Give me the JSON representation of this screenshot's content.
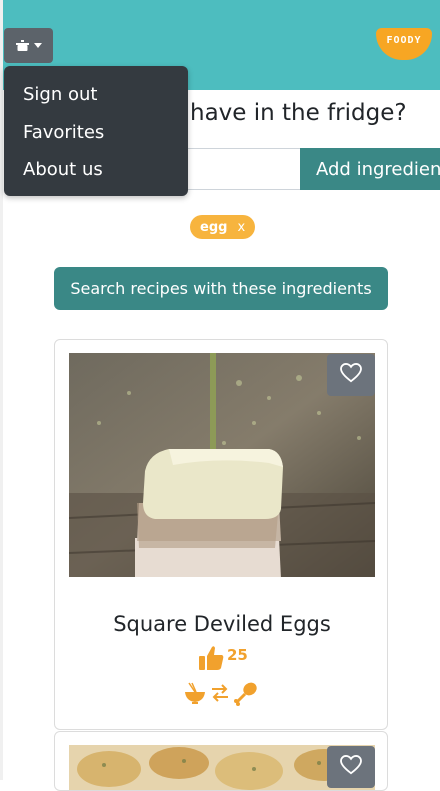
{
  "header": {
    "menu_toggle_icon": "cooking-pot-icon",
    "logo_text": "FOODY",
    "brand_color": "#4dbdbf",
    "accent_color": "#f7a623"
  },
  "dropdown": {
    "items": [
      {
        "label": "Sign out"
      },
      {
        "label": "Favorites"
      },
      {
        "label": "About us"
      }
    ]
  },
  "search": {
    "question": "have in the fridge?",
    "input_value": "",
    "add_label": "Add ingredient",
    "tags": [
      {
        "label": "egg",
        "remove": "x"
      }
    ],
    "search_label": "Search recipes with these ingredients"
  },
  "recipes": [
    {
      "title": "Square Deviled Eggs",
      "likes": "25",
      "like_icon": "thumbs-up-icon",
      "diet_icons": [
        "noodle-bowl-icon",
        "swap-arrows-icon",
        "chicken-leg-icon"
      ],
      "favorite_icon": "heart-outline-icon"
    },
    {
      "favorite_icon": "heart-outline-icon"
    }
  ]
}
